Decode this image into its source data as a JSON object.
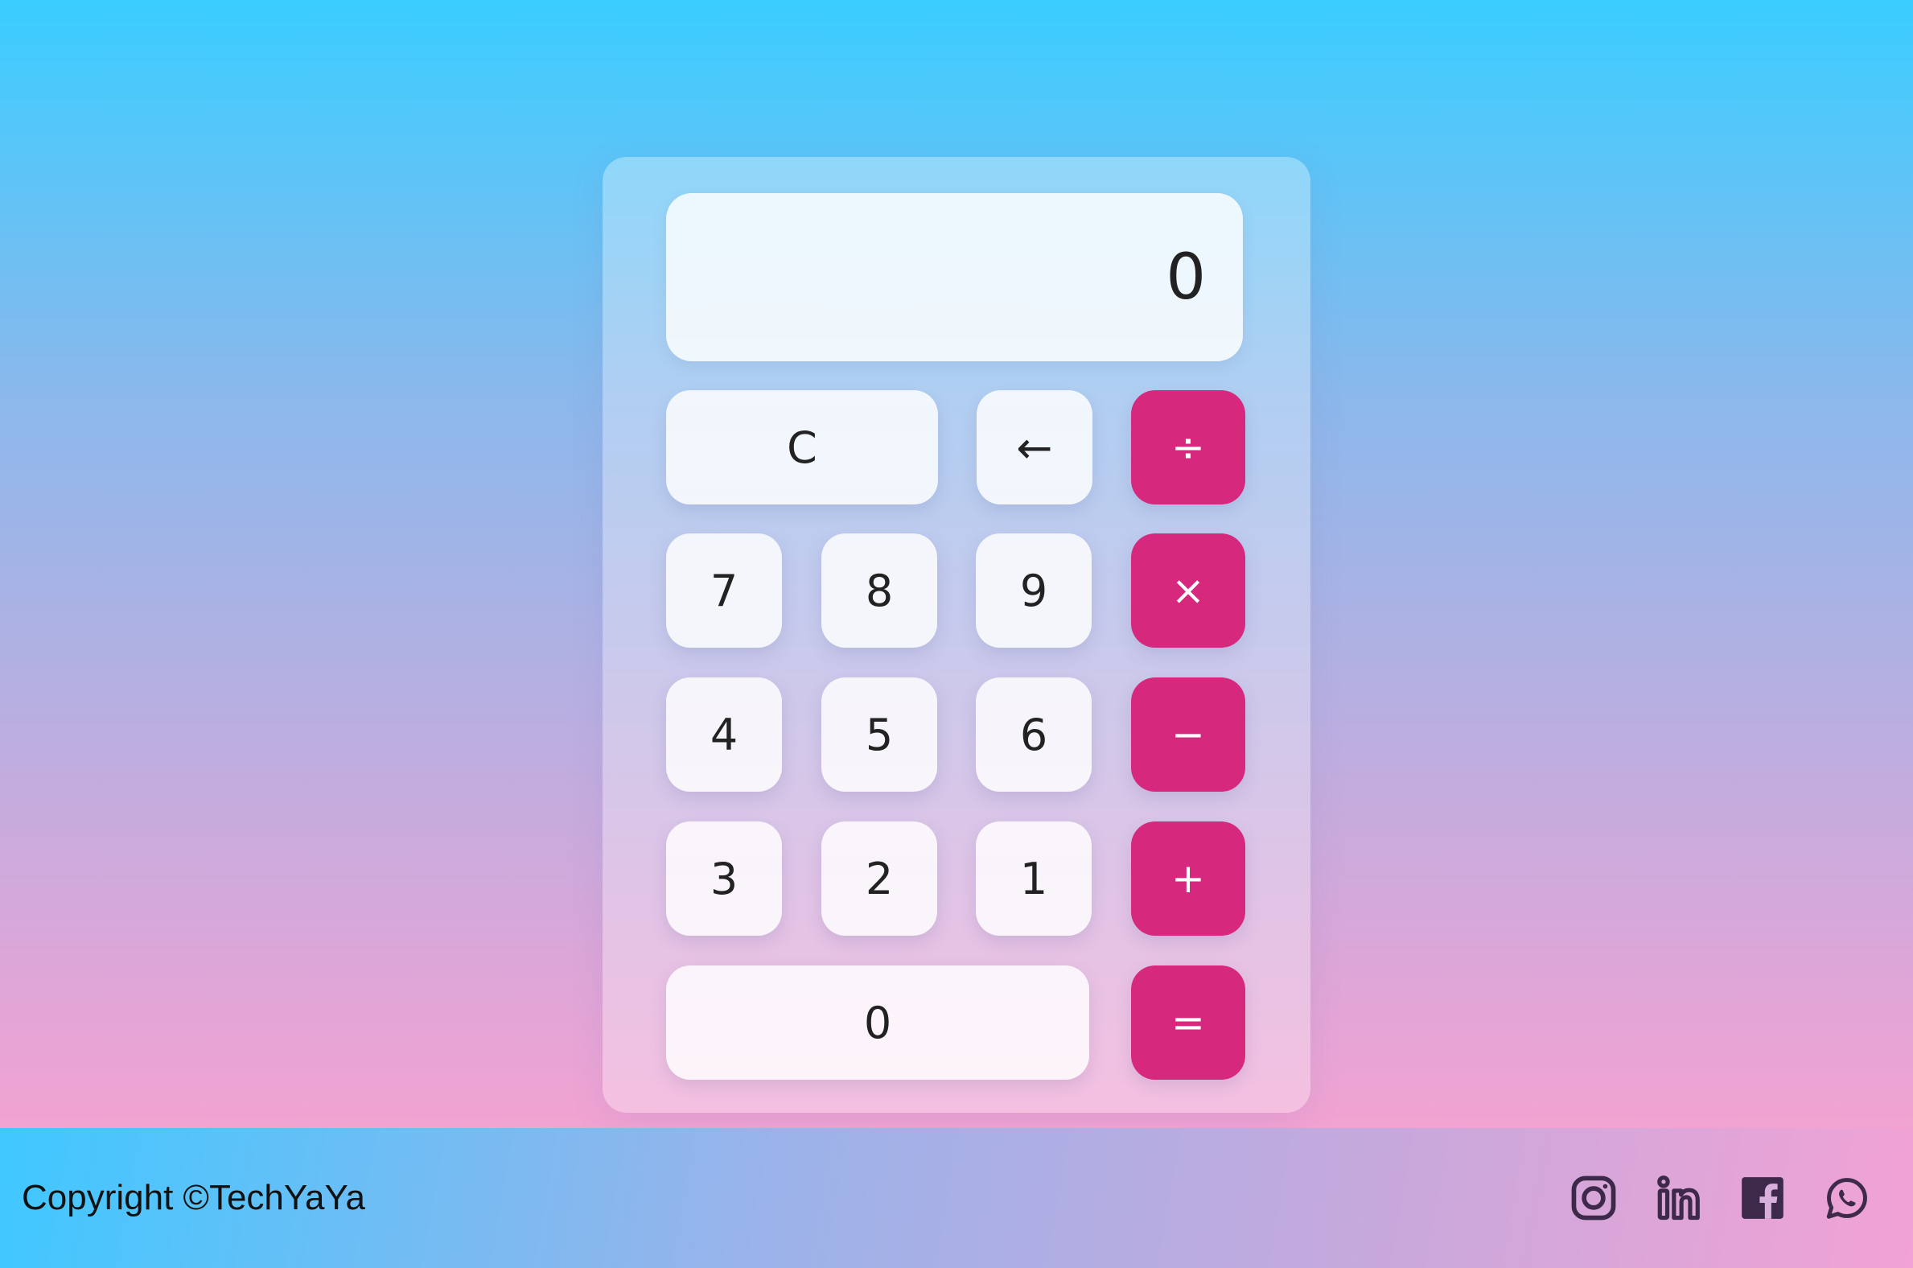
{
  "calculator": {
    "display_value": "0",
    "buttons": {
      "clear": "C",
      "backspace": "←",
      "divide": "÷",
      "multiply": "×",
      "subtract": "−",
      "add": "+",
      "equals": "=",
      "seven": "7",
      "eight": "8",
      "nine": "9",
      "four": "4",
      "five": "5",
      "six": "6",
      "three": "3",
      "two": "2",
      "one": "1",
      "zero": "0"
    }
  },
  "footer": {
    "copyright": "Copyright ©TechYaYa",
    "social_icons": [
      "instagram-icon",
      "linkedin-icon",
      "facebook-icon",
      "whatsapp-icon"
    ]
  },
  "colors": {
    "operator_button": "#d6287c",
    "icon_color": "#3d2a4a"
  }
}
